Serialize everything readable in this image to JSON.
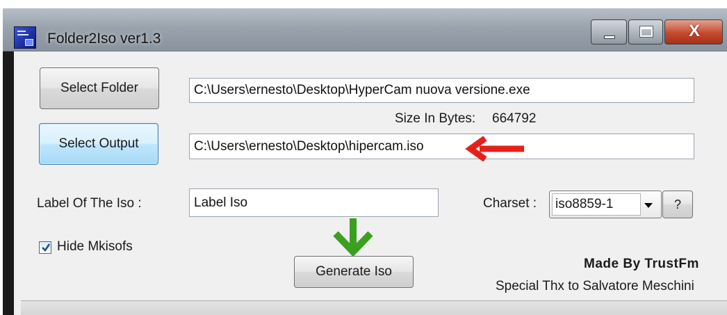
{
  "window": {
    "title": "Folder2Iso ver1.3"
  },
  "controls": {
    "close_glyph": "X"
  },
  "form": {
    "select_folder_label": "Select Folder",
    "select_output_label": "Select Output",
    "folder_path": "C:\\Users\\ernesto\\Desktop\\HyperCam nuova versione.exe",
    "size_label": "Size In Bytes:",
    "size_value": "664792",
    "output_path": "C:\\Users\\ernesto\\Desktop\\hipercam.iso",
    "label_caption": "Label Of The Iso :",
    "label_value": "Label Iso",
    "charset_caption": "Charset :",
    "charset_value": "iso8859-1",
    "help_label": "?",
    "hide_mkisofs_label": "Hide Mkisofs",
    "hide_mkisofs_checked": true,
    "generate_label": "Generate Iso"
  },
  "credits": {
    "made_by": "Made By TrustFm",
    "thanks": "Special Thx to Salvatore Meschini"
  },
  "annotations": {
    "red_arrow_color": "#e8201a",
    "green_arrow_color": "#3aa01f"
  },
  "icons": [
    "app-icon",
    "minimize-icon",
    "maximize-icon",
    "close-icon",
    "checkmark-icon",
    "red-arrow-icon",
    "green-arrow-icon",
    "dropdown-arrow-icon"
  ]
}
